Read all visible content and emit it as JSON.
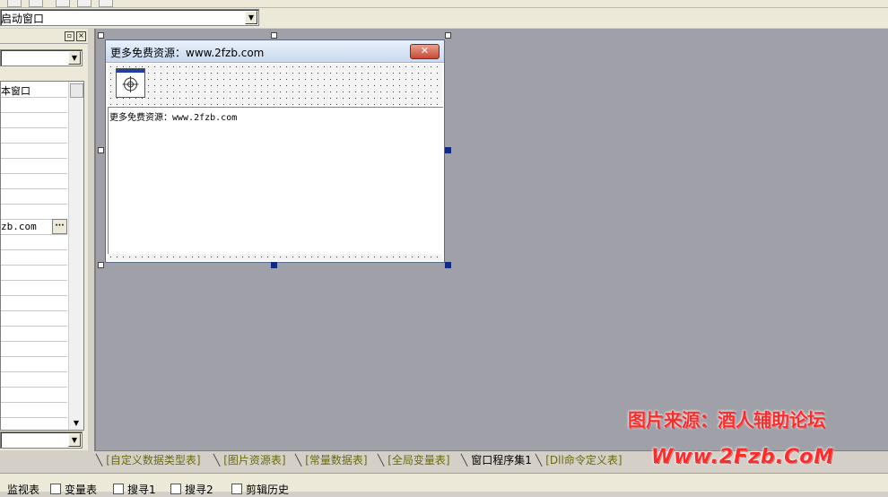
{
  "top_combo": {
    "value": "启动窗口"
  },
  "left_panel": {
    "combo_value": "",
    "rows": [
      {
        "text": "本窗口"
      },
      {
        "text": ""
      },
      {
        "text": ""
      },
      {
        "text": ""
      },
      {
        "text": ""
      },
      {
        "text": ""
      },
      {
        "text": ""
      },
      {
        "text": ""
      },
      {
        "text": ""
      },
      {
        "text": "zb.com",
        "has_button": true
      },
      {
        "text": ""
      },
      {
        "text": ""
      },
      {
        "text": ""
      },
      {
        "text": ""
      },
      {
        "text": ""
      },
      {
        "text": ""
      },
      {
        "text": ""
      },
      {
        "text": ""
      },
      {
        "text": ""
      },
      {
        "text": ""
      },
      {
        "text": ""
      },
      {
        "text": ""
      }
    ],
    "ellipsis": "···",
    "bottom_combo_value": ""
  },
  "form": {
    "title": "更多免费资源：www.2fzb.com",
    "close_label": "✕",
    "label_text": "更多免费资源：www.2fzb.com"
  },
  "tabs": [
    {
      "label": "[自定义数据类型表]"
    },
    {
      "label": "[图片资源表]"
    },
    {
      "label": "[常量数据表]"
    },
    {
      "label": "[全局变量表]"
    },
    {
      "label": "窗口程序集1",
      "active": true
    },
    {
      "label": "[Dll命令定义表]"
    }
  ],
  "bottom_tabs": [
    {
      "label": "监视表"
    },
    {
      "label": "变量表"
    },
    {
      "label": "搜寻1"
    },
    {
      "label": "搜寻2"
    },
    {
      "label": "剪辑历史"
    }
  ],
  "watermark": {
    "line1": "图片来源：酒人辅助论坛",
    "line2": "Www.2Fzb.CoM"
  }
}
